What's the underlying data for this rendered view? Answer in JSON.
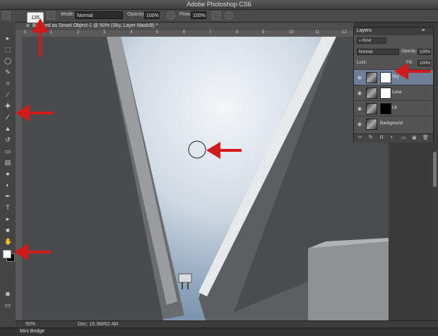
{
  "app": {
    "title": "Adobe Photoshop CS6"
  },
  "options_bar": {
    "brush_size": "135",
    "mode_label": "Mode:",
    "mode_value": "Normal",
    "opacity_label": "Opacity:",
    "opacity_value": "100%",
    "flow_label": "Flow:",
    "flow_value": "100%"
  },
  "document": {
    "tab_label": "Ba   ased as Smart Object-1 @ 50% (Sky, Layer Mask/8) *",
    "ruler_numbers": [
      "0",
      "1",
      "2",
      "3",
      "4",
      "5",
      "6",
      "7",
      "8",
      "9",
      "10",
      "11",
      "12"
    ]
  },
  "status": {
    "zoom": "50%",
    "doc_info": "Doc: 15.3M/62.4M"
  },
  "bottom_panel": {
    "label": "Mini Bridge"
  },
  "layers_panel": {
    "title": "Layers",
    "kind_label": "Kind",
    "blend_mode": "Normal",
    "opacity_label": "Opacity:",
    "opacity_value": "100%",
    "lock_label": "Lock:",
    "fill_label": "Fill:",
    "fill_value": "100%",
    "layers": [
      {
        "name": "Sky",
        "selected": true,
        "mask": "white"
      },
      {
        "name": "Luna",
        "selected": false,
        "mask": "white"
      },
      {
        "name": "L8",
        "selected": false,
        "mask": "black"
      },
      {
        "name": "Background",
        "selected": false,
        "mask": "none"
      }
    ],
    "footer_icons": [
      "link-icon",
      "fx-icon",
      "mask-icon",
      "adjustment-icon",
      "group-icon",
      "new-layer-icon",
      "trash-icon"
    ]
  },
  "annotations": {
    "arrow_color": "#d31a1a"
  },
  "colors": {
    "foreground": "#ffffff",
    "background": "#000000",
    "selection": "#6d7f97"
  }
}
